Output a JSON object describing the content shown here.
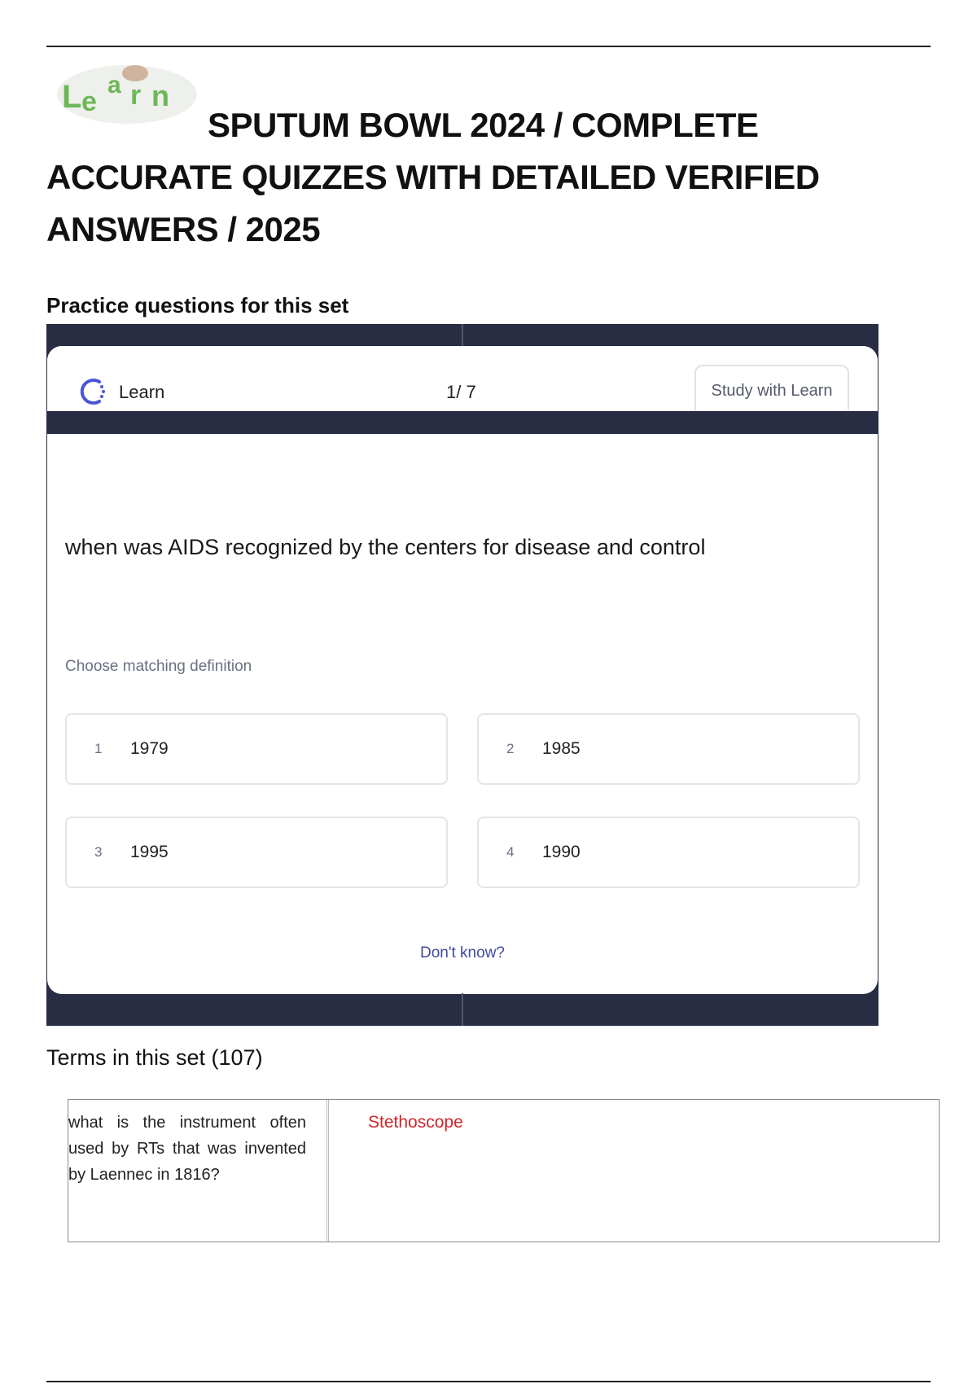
{
  "document": {
    "logo_text": "Learn",
    "title_line1": "SPUTUM BOWL 2024 / COMPLETE",
    "title_line2": "ACCURATE QUIZZES WITH DETAILED VERIFIED",
    "title_line3": "ANSWERS / 2025"
  },
  "practice": {
    "heading": "Practice questions for this set",
    "widget": {
      "brand_label": "Learn",
      "counter": "1/ 7",
      "study_button": "Study with Learn",
      "question": "when was AIDS recognized by the centers for disease and control",
      "prompt": "Choose matching definition",
      "options": [
        {
          "num": "1",
          "value": "1979"
        },
        {
          "num": "2",
          "value": "1985"
        },
        {
          "num": "3",
          "value": "1995"
        },
        {
          "num": "4",
          "value": "1990"
        }
      ],
      "dont_know": "Don't know?"
    }
  },
  "terms": {
    "heading": "Terms in this set (107)",
    "rows": [
      {
        "term": "what is the instrument often used by RTs that was invented by Laennec in 1816?",
        "definition": "Stethoscope"
      }
    ]
  },
  "colors": {
    "frame": "#282d44",
    "answer": "#d0262c",
    "link": "#3f4aa0",
    "brand_icon": "#4a55d6"
  }
}
